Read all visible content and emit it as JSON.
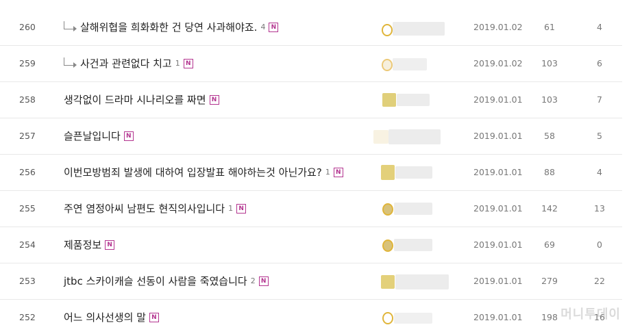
{
  "rows": [
    {
      "num": "260",
      "reply": true,
      "title": "살해위협을 희화화한 건 당연 사과해야죠.",
      "comments": "4",
      "date": "2019.01.02",
      "views": "61",
      "likes": "4"
    },
    {
      "num": "259",
      "reply": true,
      "title": "사건과 관련없다 치고",
      "comments": "1",
      "date": "2019.01.02",
      "views": "103",
      "likes": "6"
    },
    {
      "num": "258",
      "reply": false,
      "title": "생각없이 드라마 시나리오를 짜면",
      "comments": "",
      "date": "2019.01.01",
      "views": "103",
      "likes": "7"
    },
    {
      "num": "257",
      "reply": false,
      "title": "슬픈날입니다",
      "comments": "",
      "date": "2019.01.01",
      "views": "58",
      "likes": "5"
    },
    {
      "num": "256",
      "reply": false,
      "title": "이번모방범죄 발생에 대하여 입장발표 해야하는것 아닌가요?",
      "comments": "1",
      "date": "2019.01.01",
      "views": "88",
      "likes": "4"
    },
    {
      "num": "255",
      "reply": false,
      "title": "주연 염정아씨 남편도 현직의사입니다",
      "comments": "1",
      "date": "2019.01.01",
      "views": "142",
      "likes": "13"
    },
    {
      "num": "254",
      "reply": false,
      "title": "제품정보",
      "comments": "",
      "date": "2019.01.01",
      "views": "69",
      "likes": "0"
    },
    {
      "num": "253",
      "reply": false,
      "title": "jtbc 스카이캐슬 선동이 사람을 죽였습니다",
      "comments": "2",
      "date": "2019.01.01",
      "views": "279",
      "likes": "22"
    },
    {
      "num": "252",
      "reply": false,
      "title": "어느 의사선생의 말",
      "comments": "",
      "date": "2019.01.01",
      "views": "198",
      "likes": "16"
    }
  ],
  "new_badge": "N",
  "watermark": "머니투데이",
  "colors": {
    "badge": "#b3338f",
    "writer_icon": "#e0c86a"
  }
}
